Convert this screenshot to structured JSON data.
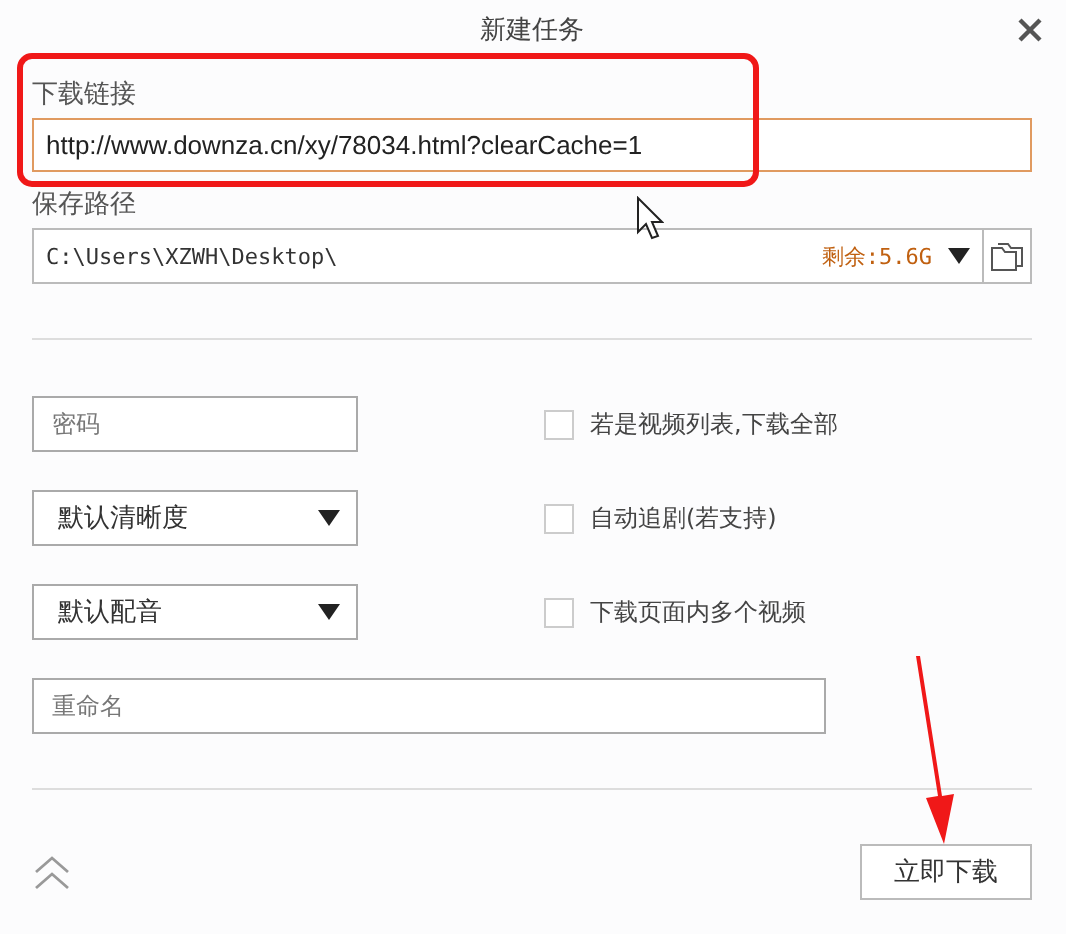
{
  "window": {
    "title": "新建任务"
  },
  "link": {
    "label": "下载链接",
    "value": "http://www.downza.cn/xy/78034.html?clearCache=1"
  },
  "save_path": {
    "label": "保存路径",
    "value": "C:\\Users\\XZWH\\Desktop\\",
    "free_space": "剩余:5.6G"
  },
  "password": {
    "placeholder": "密码"
  },
  "selects": [
    {
      "value": "默认清晰度"
    },
    {
      "value": "默认配音"
    }
  ],
  "options": [
    {
      "label": "若是视频列表,下载全部",
      "checked": false
    },
    {
      "label": "自动追剧(若支持)",
      "checked": false
    },
    {
      "label": "下载页面内多个视频",
      "checked": false
    }
  ],
  "rename": {
    "placeholder": "重命名"
  },
  "buttons": [
    "立即下载"
  ]
}
